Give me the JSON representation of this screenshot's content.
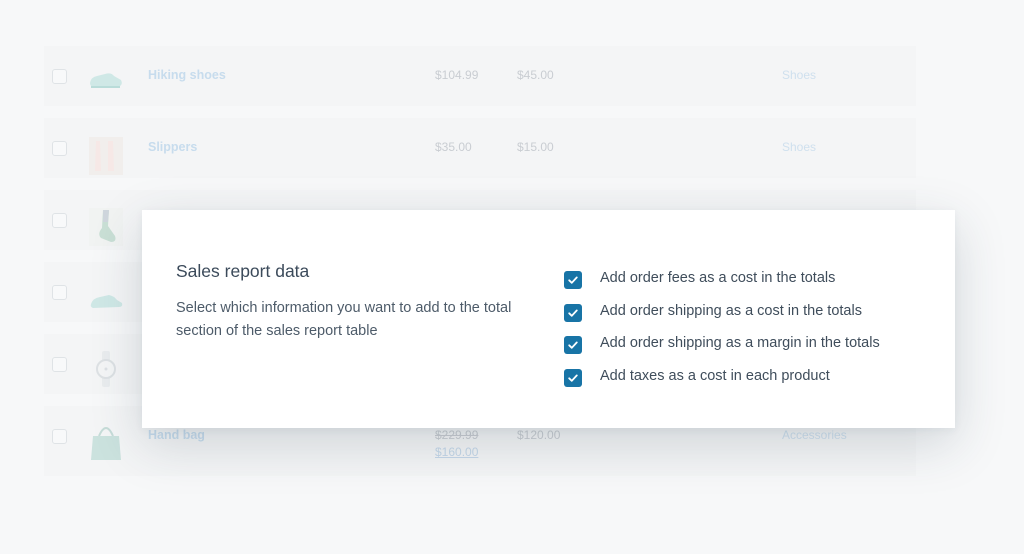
{
  "table": {
    "rows": [
      {
        "name": "Hiking shoes",
        "price": "$104.99",
        "sale_price": "",
        "cost": "$45.00",
        "category": "Shoes"
      },
      {
        "name": "Slippers",
        "price": "$35.00",
        "sale_price": "",
        "cost": "$15.00",
        "category": "Shoes"
      },
      {
        "name": "",
        "price": "",
        "sale_price": "",
        "cost": "",
        "category": ""
      },
      {
        "name": "",
        "price": "",
        "sale_price": "",
        "cost": "",
        "category": ""
      },
      {
        "name": "",
        "price": "",
        "sale_price": "",
        "cost": "",
        "category": ""
      },
      {
        "name": "Hand bag",
        "price": "$229.99",
        "sale_price": "$160.00",
        "cost": "$120.00",
        "category": "Accessories"
      }
    ]
  },
  "dialog": {
    "title": "Sales report data",
    "description": "Select which information you want to add to the total section of the sales report table",
    "options": [
      {
        "label": "Add order fees as a cost in the totals",
        "checked": true
      },
      {
        "label": "Add order shipping as a cost in the totals",
        "checked": true
      },
      {
        "label": "Add order shipping as a margin in the totals",
        "checked": true
      },
      {
        "label": "Add taxes as a cost in each product",
        "checked": true
      }
    ]
  },
  "colors": {
    "accent": "#1874a6"
  }
}
